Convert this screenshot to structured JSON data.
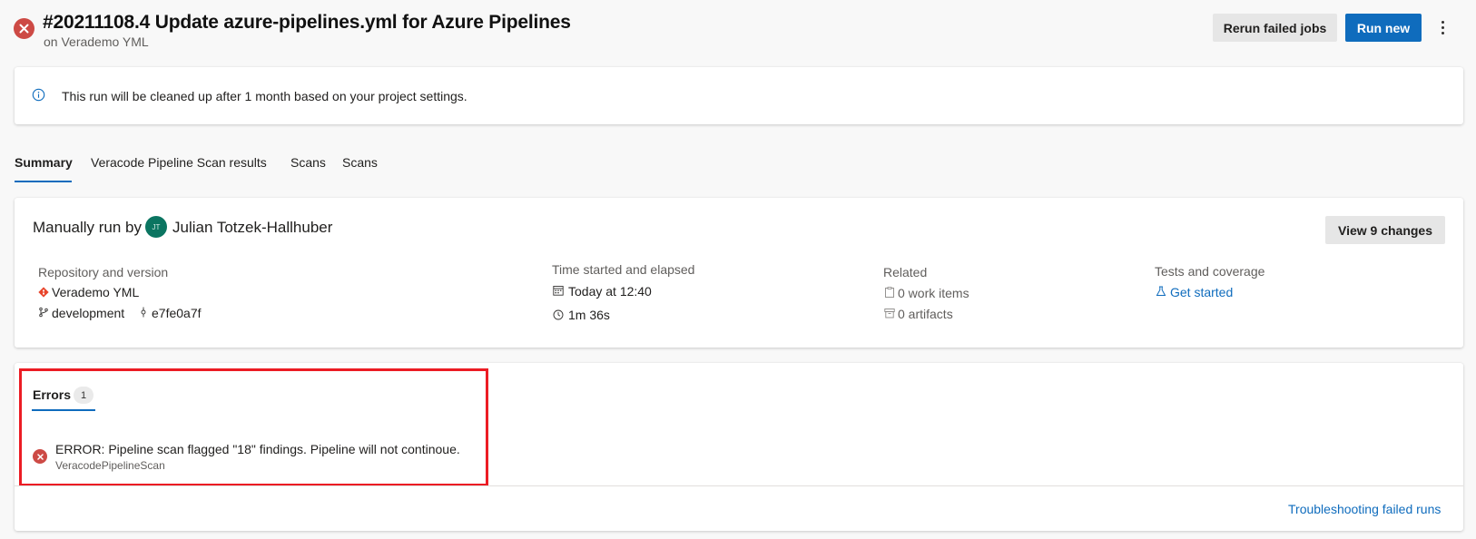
{
  "header": {
    "title": "#20211108.4 Update azure-pipelines.yml for Azure Pipelines",
    "subtitle": "on Verademo YML",
    "rerun_label": "Rerun failed jobs",
    "runnew_label": "Run new",
    "status_icon": "failed-icon",
    "status_color": "#cd4a45",
    "accent_color": "#0f6cbd"
  },
  "banner": {
    "icon": "info-icon",
    "text": "This run will be cleaned up after 1 month based on your project settings."
  },
  "tabs": [
    {
      "label": "Summary",
      "active": true
    },
    {
      "label": "Veracode Pipeline Scan results",
      "active": false
    },
    {
      "label": "Scans",
      "active": false
    },
    {
      "label": "Scans",
      "active": false
    }
  ],
  "summary": {
    "manual_label": "Manually run by",
    "avatar_initials": "JT",
    "user": "Julian Totzek-Hallhuber",
    "changes_label": "View 9 changes",
    "repo": {
      "label": "Repository and version",
      "name": "Verademo YML",
      "branch": "development",
      "commit": "e7fe0a7f"
    },
    "time": {
      "label": "Time started and elapsed",
      "started": "Today at 12:40",
      "elapsed": "1m 36s"
    },
    "related": {
      "label": "Related",
      "work_items": "0 work items",
      "artifacts": "0 artifacts"
    },
    "tests": {
      "label": "Tests and coverage",
      "link": "Get started"
    }
  },
  "errors": {
    "tab_label": "Errors",
    "count": "1",
    "items": [
      {
        "message": "ERROR: Pipeline scan flagged \"18\" findings. Pipeline will not continoue.",
        "source": "VeracodePipelineScan"
      }
    ],
    "troubleshoot_link": "Troubleshooting failed runs",
    "highlight_color": "#ec1c24"
  }
}
